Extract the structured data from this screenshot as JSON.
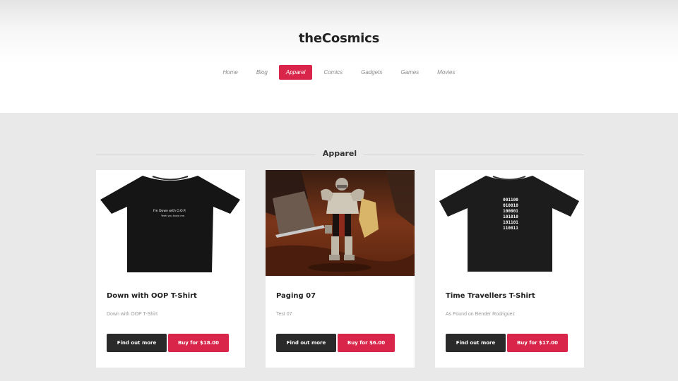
{
  "site": {
    "brand": "theCosmics"
  },
  "nav": {
    "items": [
      {
        "label": "Home"
      },
      {
        "label": "Blog"
      },
      {
        "label": "Apparel",
        "active": true
      },
      {
        "label": "Comics"
      },
      {
        "label": "Gadgets"
      },
      {
        "label": "Games"
      },
      {
        "label": "Movies"
      }
    ]
  },
  "section": {
    "title": "Apparel"
  },
  "products": [
    {
      "title": "Down with OOP T-Shirt",
      "description": "Down with OOP T-Shirt",
      "more_label": "Find out more",
      "buy_label": "Buy for $18.00",
      "image": "black-tshirt-oop",
      "print_line1": "I'm Down with O.O.P.",
      "print_line2": "Yeah you know me."
    },
    {
      "title": "Paging 07",
      "description": "Test 07",
      "more_label": "Find out more",
      "buy_label": "Buy for $6.00",
      "image": "armored-knight-game-scene"
    },
    {
      "title": "Time Travellers T-Shirt",
      "description": "As Found on Bender Rodriguez",
      "more_label": "Find out more",
      "buy_label": "Buy for $17.00",
      "image": "black-tshirt-binary",
      "binary_rows": [
        "001100",
        "010010",
        "100001",
        "101010",
        "101101",
        "110011"
      ]
    }
  ],
  "colors": {
    "accent": "#d9254a",
    "dark_button": "#2a2a2a",
    "background": "#e9e9e9"
  }
}
